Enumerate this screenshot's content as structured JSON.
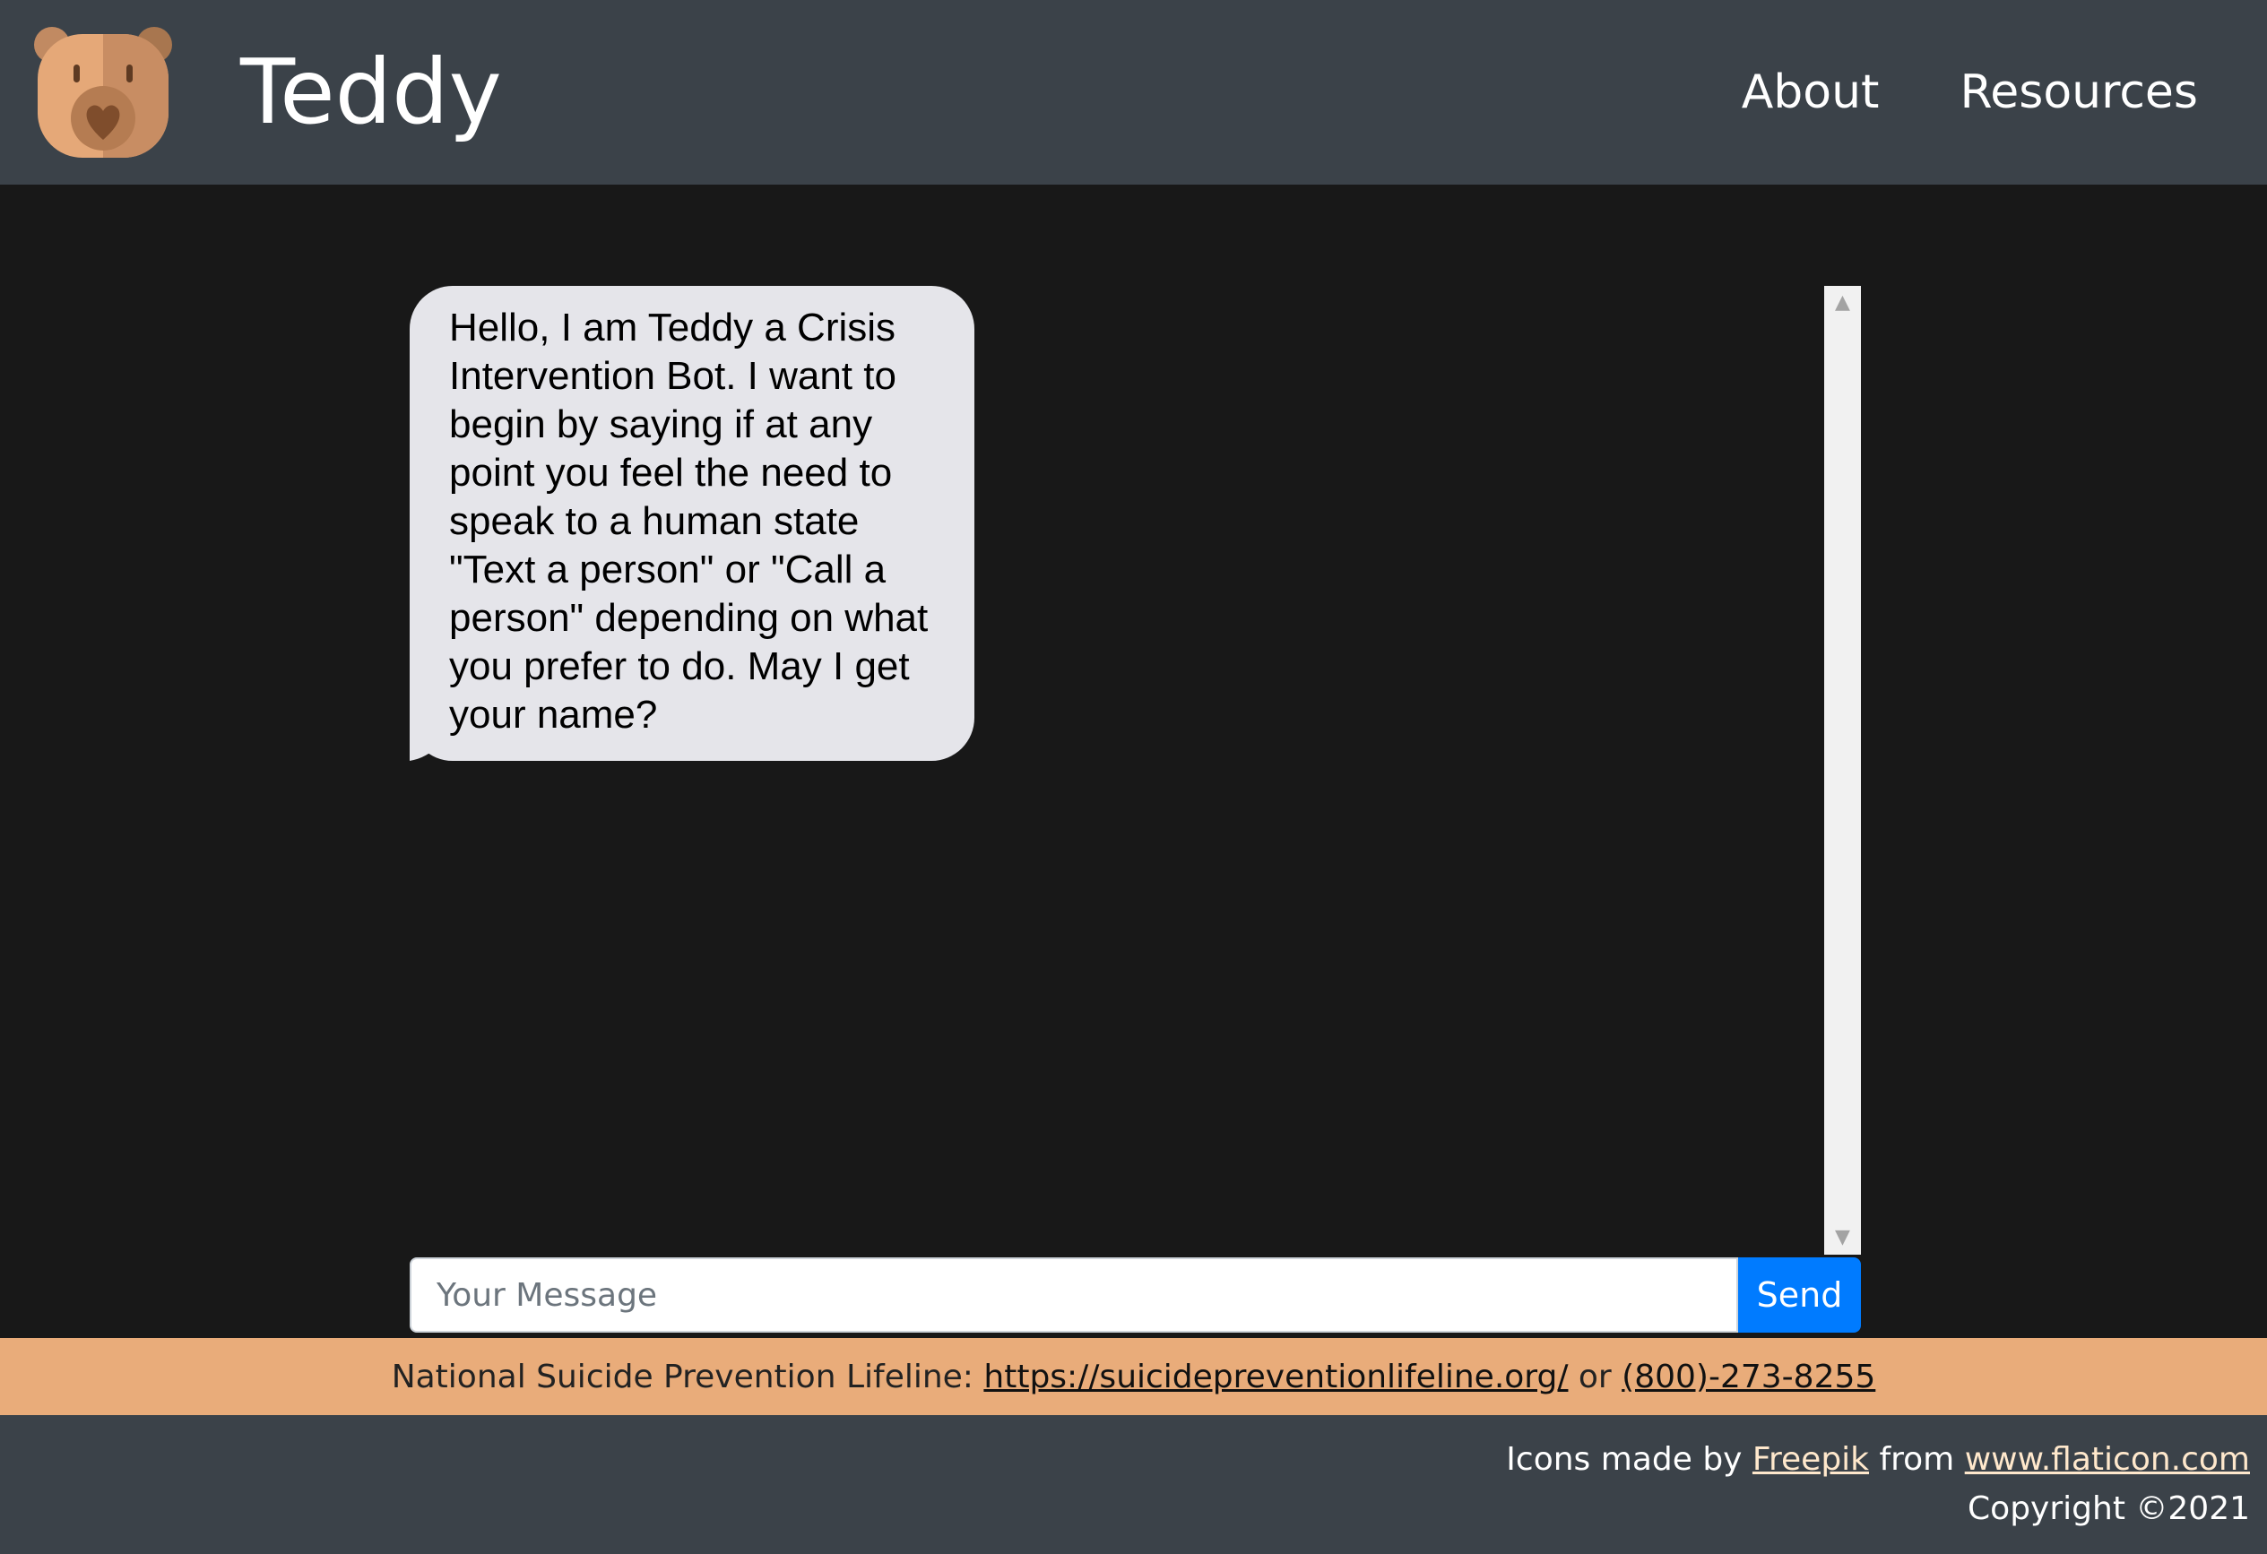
{
  "header": {
    "brand_name": "Teddy",
    "logo_icon": "teddy-bear-icon",
    "nav": [
      {
        "label": "About"
      },
      {
        "label": "Resources"
      }
    ]
  },
  "chat": {
    "messages": [
      {
        "sender": "bot",
        "text": "Hello, I am Teddy a Crisis Intervention Bot. I want to begin by saying if at any point you feel the need to speak to a human state \"Text a person\" or \"Call a person\" depending on what you prefer to do. May I get your name?"
      }
    ],
    "input": {
      "value": "",
      "placeholder": "Your Message"
    },
    "send_label": "Send"
  },
  "lifeline": {
    "prefix": "National Suicide Prevention Lifeline: ",
    "url_text": "https://suicidepreventionlifeline.org/",
    "separator": " or ",
    "phone": "(800)-273-8255"
  },
  "footer": {
    "credit_prefix": "Icons made by ",
    "author": "Freepik",
    "credit_middle": " from ",
    "site": "www.flaticon.com",
    "copyright": "Copyright ©2021"
  },
  "colors": {
    "header_bg": "#3b4249",
    "chat_bg": "#181818",
    "bubble_bg": "#e5e5ea",
    "send_button": "#007bff",
    "lifeline_bg": "#e9ac7a"
  }
}
